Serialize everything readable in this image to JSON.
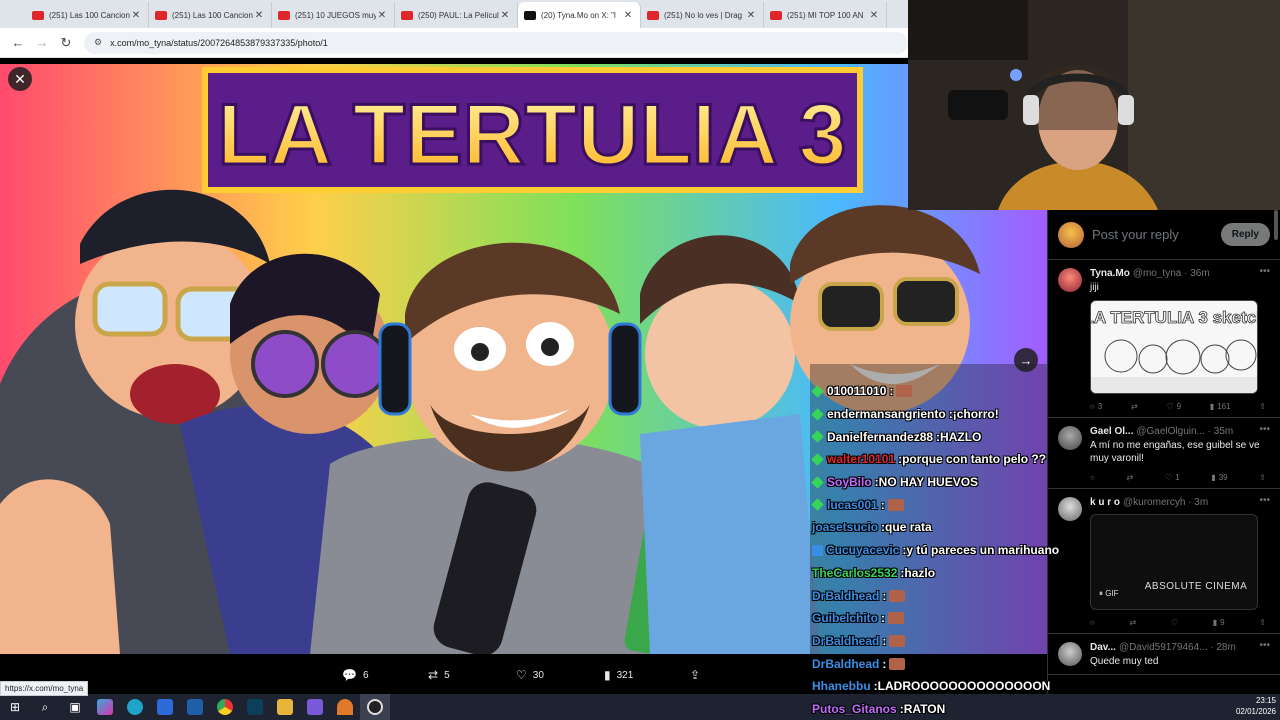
{
  "tabs": [
    {
      "title": "(251) Las 100 Cancion",
      "icon": "youtube-icon",
      "active": false
    },
    {
      "title": "(251) Las 100 Cancion",
      "icon": "youtube-icon",
      "active": false
    },
    {
      "title": "(251) 10 JUEGOS muy",
      "icon": "youtube-icon",
      "active": false
    },
    {
      "title": "(250) PAUL: La Películ",
      "icon": "youtube-icon",
      "active": false
    },
    {
      "title": "(20) Tyna.Mo on X: \"l",
      "icon": "x-icon",
      "active": true
    },
    {
      "title": "(251) No lo ves | Drag",
      "icon": "youtube-icon",
      "active": false
    },
    {
      "title": "(251) MI TOP 100 AN",
      "icon": "youtube-icon",
      "active": false
    }
  ],
  "address": {
    "url": "x.com/mo_tyna/status/2007264853879337335/photo/1"
  },
  "artwork": {
    "title": "LA TERTULIA 3"
  },
  "actions": {
    "replies": "6",
    "reposts": "5",
    "likes": "30",
    "views": "321"
  },
  "status_url": "https://x.com/mo_tyna",
  "reply_box": {
    "placeholder": "Post your reply",
    "button": "Reply"
  },
  "tweets": [
    {
      "name": "Tyna.Mo",
      "handle": "@mo_tyna · 36m",
      "text": "jiji",
      "replies": "3",
      "reposts": "",
      "likes": "9",
      "views": "161",
      "media": "LA TERTULIA 3 sketch"
    },
    {
      "name": "Gael Ol...",
      "handle": "@GaelOlguin... · 35m",
      "text": "A mí no me engañas, ese guibel se ve muy varonil!",
      "replies": "",
      "reposts": "",
      "likes": "1",
      "views": "39"
    },
    {
      "name": "k u r o",
      "handle": "@kuromercyh · 3m",
      "text": "",
      "replies": "",
      "reposts": "",
      "likes": "",
      "views": "9",
      "gif_caption": "ABSOLUTE CINEMA",
      "gif_label": "GIF"
    },
    {
      "name": "Dav...",
      "handle": "@David59179464... · 28m",
      "text": "Quede muy ted"
    }
  ],
  "chat": [
    {
      "user": "010011010",
      "sep": " :",
      "text": "",
      "user_color": "#ffffff",
      "badge": "sub",
      "emote": true
    },
    {
      "user": "endermansangriento",
      "sep": " :",
      "text": " ¡chorro!",
      "user_color": "#ffffff",
      "badge": "sub"
    },
    {
      "user": "Danielfernandez88",
      "sep": " :",
      "text": " HAZLO",
      "user_color": "#ffffff",
      "badge": "multi"
    },
    {
      "user": "walter10101",
      "sep": " :",
      "text": " porque con tanto pelo ??",
      "user_color": "#e0262a",
      "badge": "sub"
    },
    {
      "user": "SoyBilo",
      "sep": " :",
      "text": " NO HAY HUEVOS",
      "user_color": "#c06bff",
      "badge": "sub"
    },
    {
      "user": "lucas001",
      "sep": " :",
      "text": "",
      "user_color": "#3a8ee6",
      "badge": "sub",
      "emote": true
    },
    {
      "user": "joasetsucio",
      "sep": " :",
      "text": " que rata",
      "user_color": "#3a8ee6",
      "badge": ""
    },
    {
      "user": "Cucuyacevic",
      "sep": " :",
      "text": " y tú pareces un marihuano",
      "user_color": "#3a8ee6",
      "badge": "blue"
    },
    {
      "user": "TheCarlos2532",
      "sep": " :",
      "text": " hazlo",
      "user_color": "#37d45a",
      "badge": ""
    },
    {
      "user": "DrBaldhead",
      "sep": " :",
      "text": "",
      "user_color": "#3a8ee6",
      "badge": "",
      "emote": true
    },
    {
      "user": "Guibelchito",
      "sep": " :",
      "text": "",
      "user_color": "#3a8ee6",
      "badge": "",
      "emote": true
    },
    {
      "user": "DrBaldhead",
      "sep": " :",
      "text": "",
      "user_color": "#3a8ee6",
      "badge": "",
      "emote": true
    },
    {
      "user": "DrBaldhead",
      "sep": " :",
      "text": "",
      "user_color": "#3a8ee6",
      "badge": "",
      "emote": true
    },
    {
      "user": "Hhanebbu",
      "sep": " :",
      "text": " LADROOOOOOOOOOOOOON",
      "user_color": "#3a8ee6",
      "badge": ""
    },
    {
      "user": "Putos_Gitanos",
      "sep": " :",
      "text": " RATON",
      "user_color": "#c06bff",
      "badge": ""
    }
  ],
  "clock": {
    "time": "23:15",
    "date": "02/01/2026"
  }
}
